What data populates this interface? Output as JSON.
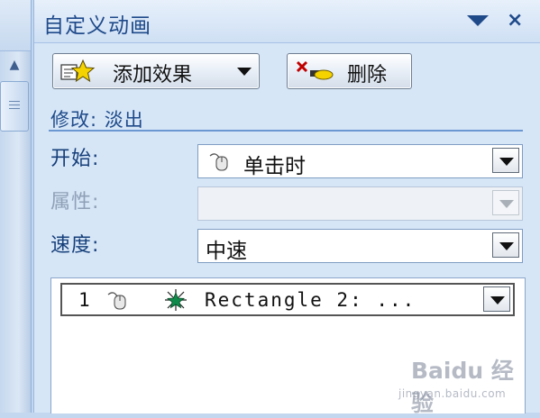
{
  "pane": {
    "title": "自定义动画",
    "add_effect_label": "添加效果",
    "remove_label": "删除",
    "modify_label": "修改: 淡出"
  },
  "fields": {
    "start": {
      "label": "开始:",
      "value": "单击时"
    },
    "property": {
      "label": "属性:",
      "value": ""
    },
    "speed": {
      "label": "速度:",
      "value": "中速"
    }
  },
  "effects_list": {
    "items": [
      {
        "number": "1",
        "name": "Rectangle 2: ..."
      }
    ]
  },
  "watermark": {
    "main": "Baidu 经验",
    "sub": "jingyan.baidu.com"
  },
  "colors": {
    "pane_bg": "#d6e6f7",
    "title_text": "#1f4a8a",
    "separator": "#6c98d2",
    "star_add": "#f5d300",
    "star_effect": "#0f8a4a"
  },
  "icons": {
    "add_effect": "star-add-icon",
    "remove": "remove-x-icon",
    "start_mouse": "mouse-icon",
    "item_mouse": "mouse-icon",
    "item_effect": "green-star-icon"
  }
}
